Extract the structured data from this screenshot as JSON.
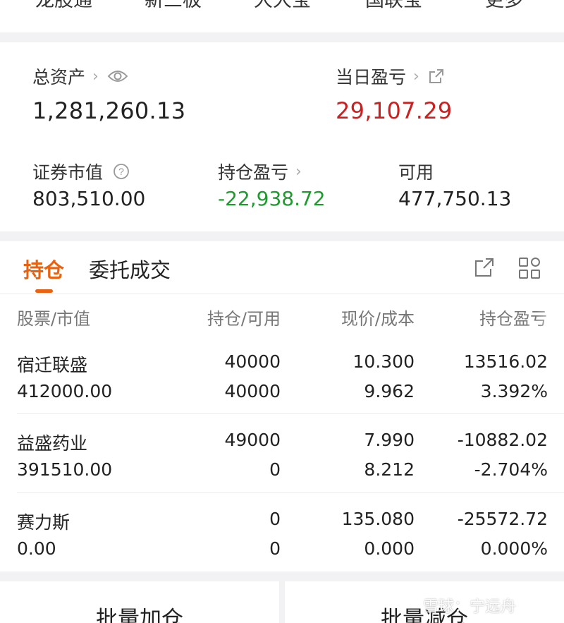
{
  "top_nav": {
    "items": [
      "龙股通",
      "新三板",
      "大大宝",
      "国联宝",
      "更多"
    ]
  },
  "assets": {
    "total_assets_label": "总资产",
    "total_assets_value": "1,281,260.13",
    "daily_pnl_label": "当日盈亏",
    "daily_pnl_value": "29,107.29",
    "market_value_label": "证券市值",
    "market_value_value": "803,510.00",
    "position_pnl_label": "持仓盈亏",
    "position_pnl_value": "-22,938.72",
    "available_label": "可用",
    "available_value": "477,750.13"
  },
  "positions": {
    "tabs": [
      "持仓",
      "委托成交"
    ],
    "headers": [
      "股票/市值",
      "持仓/可用",
      "现价/成本",
      "持仓盈亏"
    ],
    "rows": [
      {
        "name": "宿迁联盛",
        "market_value": "412000.00",
        "holding": "40000",
        "available": "40000",
        "price": "10.300",
        "cost": "9.962",
        "pnl": "13516.02",
        "pnl_pct": "3.392%",
        "status": "gain"
      },
      {
        "name": "益盛药业",
        "market_value": "391510.00",
        "holding": "49000",
        "available": "0",
        "price": "7.990",
        "cost": "8.212",
        "pnl": "-10882.02",
        "pnl_pct": "-2.704%",
        "status": "loss"
      },
      {
        "name": "赛力斯",
        "market_value": "0.00",
        "holding": "0",
        "available": "0",
        "price": "135.080",
        "cost": "0.000",
        "pnl": "-25572.72",
        "pnl_pct": "0.000%",
        "status": "loss"
      }
    ]
  },
  "bottom_actions": {
    "add_label": "批量加仓",
    "reduce_label": "批量减仓"
  },
  "watermark": {
    "text": "雪球：宁远舟"
  },
  "colors": {
    "gain": "#cc1f1f",
    "loss": "#1f9a2e",
    "accent": "#e8620f"
  },
  "icons": [
    "chevron-right-icon",
    "eye-icon",
    "external-link-icon",
    "help-circle-icon",
    "share-icon",
    "grid-icon"
  ]
}
